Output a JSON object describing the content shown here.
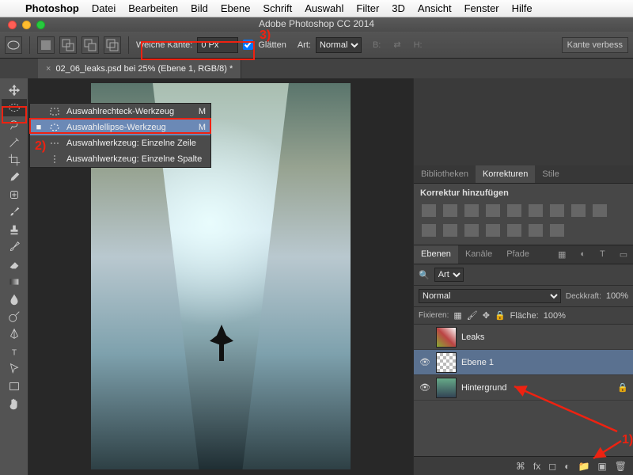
{
  "menubar": [
    "Photoshop",
    "Datei",
    "Bearbeiten",
    "Bild",
    "Ebene",
    "Schrift",
    "Auswahl",
    "Filter",
    "3D",
    "Ansicht",
    "Fenster",
    "Hilfe"
  ],
  "window_title": "Adobe Photoshop CC 2014",
  "options": {
    "feather_label": "Weiche Kante:",
    "feather_value": "0 Px",
    "antialias_label": "Glätten",
    "style_label": "Art:",
    "style_value": "Normal",
    "width_label": "B:",
    "height_label": "H:",
    "refine": "Kante verbess"
  },
  "tab_title": "02_06_leaks.psd bei 25% (Ebene 1, RGB/8) *",
  "flyout": {
    "items": [
      {
        "mark": "",
        "label": "Auswahlrechteck-Werkzeug",
        "key": "M"
      },
      {
        "mark": "■",
        "label": "Auswahlellipse-Werkzeug",
        "key": "M",
        "sel": true
      },
      {
        "mark": "",
        "label": "Auswahlwerkzeug: Einzelne Zeile",
        "key": ""
      },
      {
        "mark": "",
        "label": "Auswahlwerkzeug: Einzelne Spalte",
        "key": ""
      }
    ]
  },
  "panel_tabs1": [
    "Bibliotheken",
    "Korrekturen",
    "Stile"
  ],
  "adjust_label": "Korrektur hinzufügen",
  "panel_tabs2": [
    "Ebenen",
    "Kanäle",
    "Pfade"
  ],
  "layer_filter": "Art",
  "blend_mode": "Normal",
  "opacity_label": "Deckkraft:",
  "opacity_value": "100%",
  "lock_label": "Fixieren:",
  "fill_label": "Fläche:",
  "fill_value": "100%",
  "layers": [
    {
      "eye": "",
      "name": "Leaks",
      "thumb": "img",
      "sel": false,
      "lock": ""
    },
    {
      "eye": "👁",
      "name": "Ebene 1",
      "thumb": "checker",
      "sel": true,
      "lock": ""
    },
    {
      "eye": "👁",
      "name": "Hintergrund",
      "thumb": "img",
      "sel": false,
      "lock": "🔒"
    }
  ],
  "annotations": {
    "a1": "1)",
    "a2": "2)",
    "a3": "3)"
  }
}
